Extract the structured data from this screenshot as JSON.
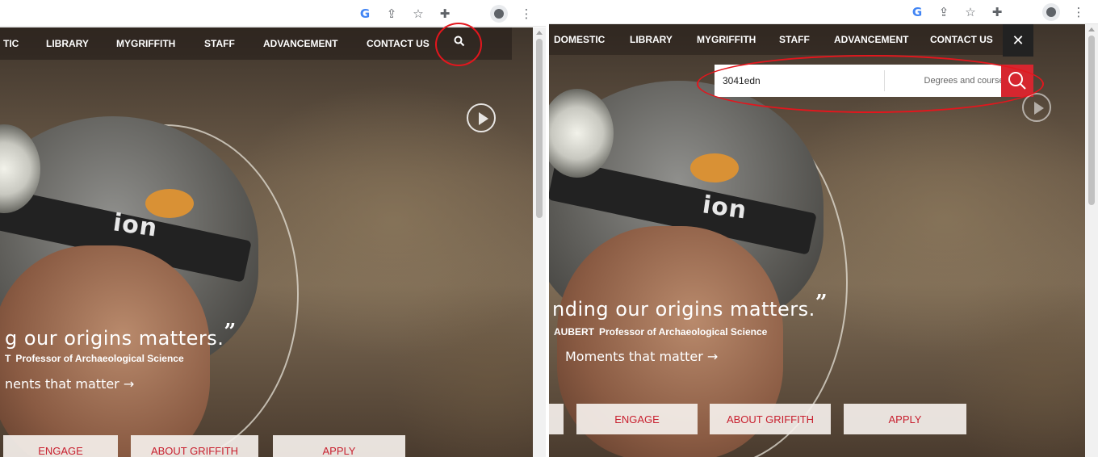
{
  "left_panel": {
    "chrome": {
      "icons": [
        "google-icon",
        "share-icon",
        "star-icon",
        "extensions-icon",
        "side-panel-icon",
        "profile-icon",
        "more-menu-icon"
      ]
    },
    "nav": {
      "items": [
        "TIC",
        "LIBRARY",
        "MYGRIFFITH",
        "STAFF",
        "ADVANCEMENT",
        "CONTACT US"
      ]
    },
    "hero": {
      "quote_text": "g our origins matters.",
      "quote_close": "”",
      "attribution_name": "T",
      "attribution_role": "Professor of Archaeological Science",
      "moments_link": "nents that matter →"
    },
    "buttons": {
      "engage": "ENGAGE",
      "about": "ABOUT GRIFFITH",
      "apply": "APPLY"
    }
  },
  "right_panel": {
    "chrome": {
      "icons": [
        "google-icon",
        "share-icon",
        "star-icon",
        "extensions-icon",
        "side-panel-icon",
        "profile-icon",
        "more-menu-icon"
      ]
    },
    "nav": {
      "items": [
        "DOMESTIC",
        "LIBRARY",
        "MYGRIFFITH",
        "STAFF",
        "ADVANCEMENT",
        "CONTACT US"
      ],
      "close_label": "✕"
    },
    "search": {
      "value": "3041edn",
      "scope_selected": "Degrees and courses"
    },
    "hero": {
      "quote_text": "nding our origins matters.",
      "quote_close": "”",
      "attribution_name": "AUBERT",
      "attribution_role": "Professor of Archaeological Science",
      "moments_link": "Moments that matter →"
    },
    "buttons": {
      "engage": "ENGAGE",
      "about": "ABOUT GRIFFITH",
      "apply": "APPLY"
    }
  },
  "colors": {
    "accent_red": "#d6262f",
    "annotation_red": "#e3161d",
    "cta_text": "#c8202f"
  }
}
